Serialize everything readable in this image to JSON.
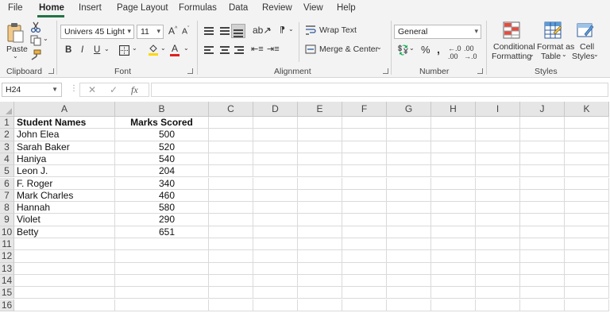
{
  "menu": {
    "tabs": [
      {
        "label": "File"
      },
      {
        "label": "Home"
      },
      {
        "label": "Insert"
      },
      {
        "label": "Page Layout"
      },
      {
        "label": "Formulas"
      },
      {
        "label": "Data"
      },
      {
        "label": "Review"
      },
      {
        "label": "View"
      },
      {
        "label": "Help"
      }
    ],
    "active": "Home"
  },
  "ribbon": {
    "clipboard": {
      "paste_label": "Paste",
      "group_label": "Clipboard"
    },
    "font": {
      "font_name": "Univers 45 Light",
      "font_size": "11",
      "group_label": "Font",
      "bold": "B",
      "italic": "I",
      "underline": "U"
    },
    "alignment": {
      "wrap_text": "Wrap Text",
      "merge_center": "Merge & Center",
      "group_label": "Alignment"
    },
    "number": {
      "format": "General",
      "group_label": "Number"
    },
    "styles": {
      "conditional_l1": "Conditional",
      "conditional_l2": "Formatting",
      "format_table_l1": "Format as",
      "format_table_l2": "Table",
      "cell_styles_l1": "Cell",
      "cell_styles_l2": "Styles",
      "group_label": "Styles"
    },
    "colors": {
      "accent": "#217346",
      "font_color": "#e02020",
      "fill_color": "#ffd700"
    }
  },
  "formula_bar": {
    "name_box": "H24",
    "fx_label": "fx",
    "formula": ""
  },
  "sheet": {
    "columns": [
      "A",
      "B",
      "C",
      "D",
      "E",
      "F",
      "G",
      "H",
      "I",
      "J",
      "K"
    ],
    "row_numbers": [
      "1",
      "2",
      "3",
      "4",
      "5",
      "6",
      "7",
      "8",
      "9",
      "10",
      "11",
      "12",
      "13",
      "14",
      "15",
      "16"
    ],
    "headers": [
      "Student Names",
      "Marks Scored"
    ],
    "rows": [
      {
        "name": "John Elea",
        "marks": "500"
      },
      {
        "name": "Sarah Baker",
        "marks": "520"
      },
      {
        "name": "Haniya",
        "marks": "540"
      },
      {
        "name": "Leon J.",
        "marks": "204"
      },
      {
        "name": "F. Roger",
        "marks": "340"
      },
      {
        "name": "Mark Charles",
        "marks": "460"
      },
      {
        "name": "Hannah",
        "marks": "580"
      },
      {
        "name": "Violet",
        "marks": "290"
      },
      {
        "name": "Betty",
        "marks": "651"
      }
    ]
  }
}
